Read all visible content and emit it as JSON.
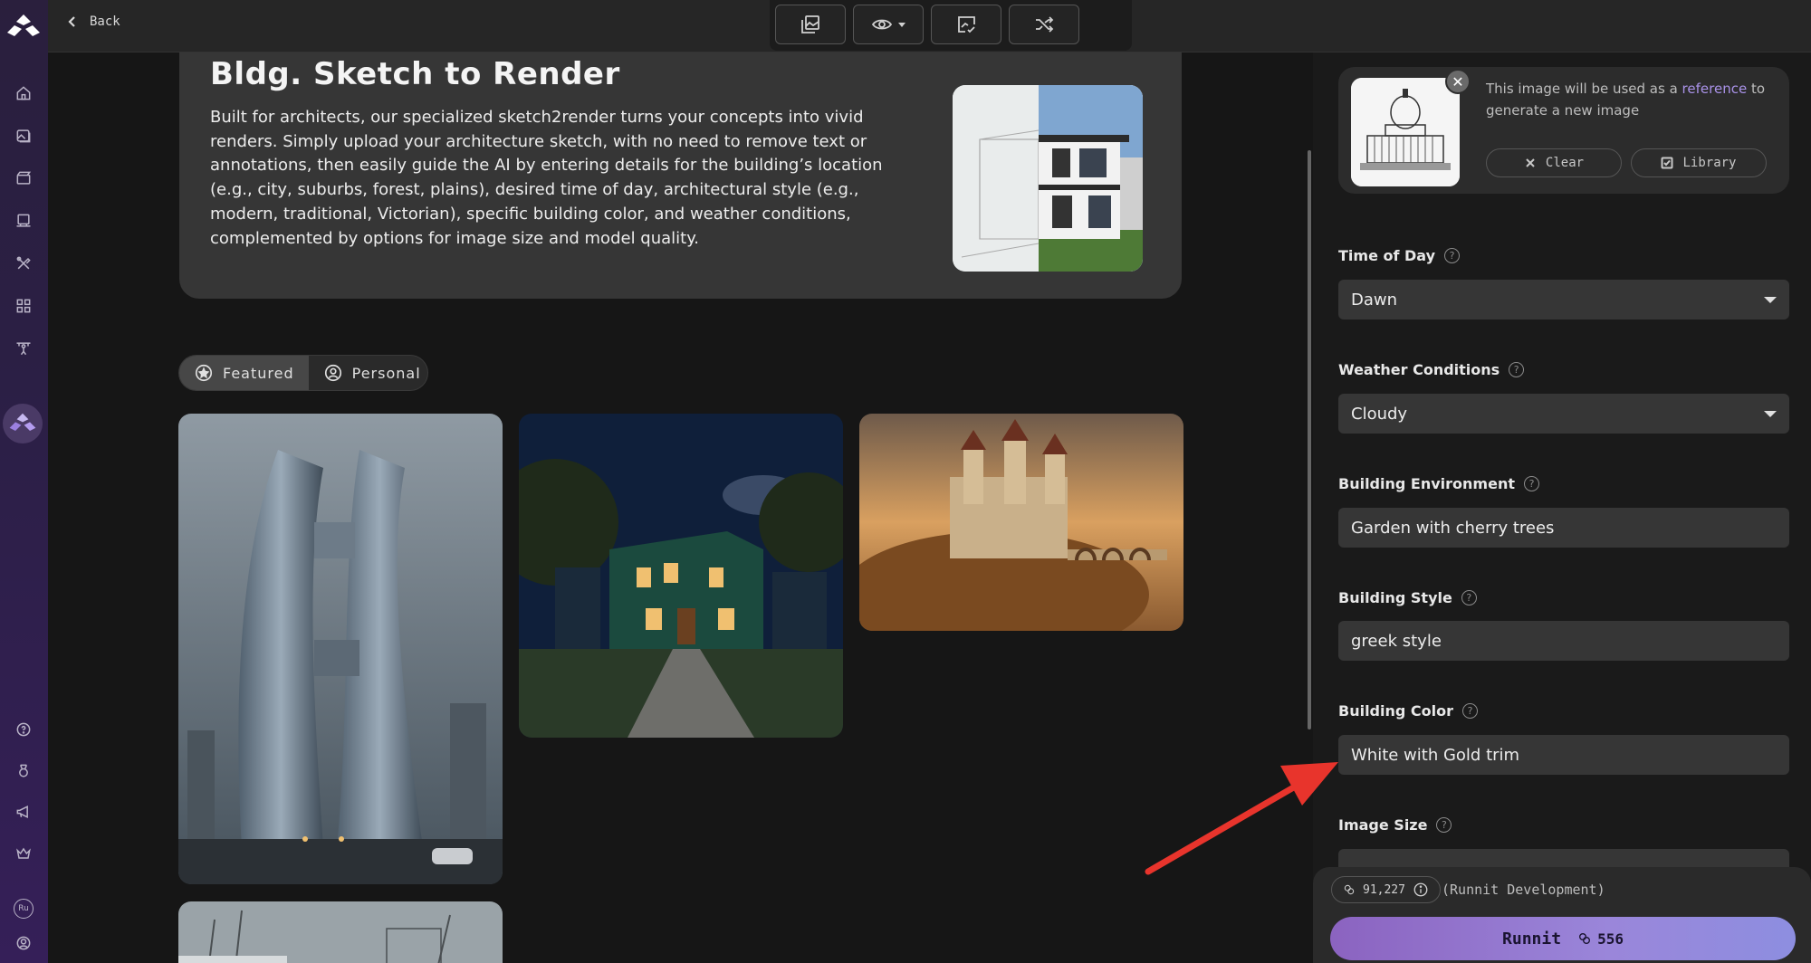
{
  "topbar": {
    "back_label": "Back"
  },
  "info": {
    "title": "Bldg. Sketch to Render",
    "description": "Built for architects, our specialized sketch2render turns your concepts into vivid renders. Simply upload your architecture sketch, with no need to remove text or annotations, then easily guide the AI by entering details for the building’s location (e.g., city, suburbs, forest, plains), desired time of day, architectural style (e.g., modern, traditional, Victorian), specific building color, and weather conditions, complemented by options for image size and model quality."
  },
  "gallery": {
    "tabs": {
      "featured": "Featured",
      "personal": "Personal"
    }
  },
  "reference": {
    "text_before": "This image will be used as a ",
    "link": "reference",
    "text_after": " to generate a new image",
    "clear_label": "Clear",
    "library_label": "Library"
  },
  "form": {
    "time_of_day": {
      "label": "Time of Day",
      "value": "Dawn"
    },
    "weather": {
      "label": "Weather Conditions",
      "value": "Cloudy"
    },
    "environment": {
      "label": "Building Environment",
      "value": "Garden with cherry trees"
    },
    "style": {
      "label": "Building Style",
      "value": "greek style"
    },
    "color": {
      "label": "Building Color",
      "value": "White with Gold trim"
    },
    "image_size": {
      "label": "Image Size"
    }
  },
  "footer": {
    "credits": "91,227",
    "environment": "(Runnit Development)",
    "run_label": "Runnit",
    "run_cost": "556"
  },
  "user": {
    "initials": "Ru"
  },
  "colors": {
    "accent": "#9a86da",
    "annotation_arrow": "#e8342c",
    "rail": "#2b1f45"
  }
}
